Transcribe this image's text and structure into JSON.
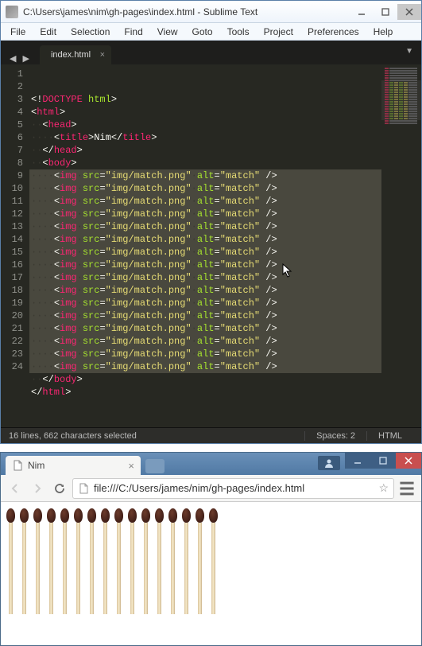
{
  "sublime": {
    "title": "C:\\Users\\james\\nim\\gh-pages\\index.html - Sublime Text",
    "menus": [
      "File",
      "Edit",
      "Selection",
      "Find",
      "View",
      "Goto",
      "Tools",
      "Project",
      "Preferences",
      "Help"
    ],
    "tab": "index.html",
    "lines": [
      {
        "num": 1,
        "sel": false,
        "indent": 0,
        "segments": [
          {
            "t": "<!",
            "c": "punct"
          },
          {
            "t": "DOCTYPE",
            "c": "tag"
          },
          {
            "t": " ",
            "c": "punct"
          },
          {
            "t": "html",
            "c": "attr"
          },
          {
            "t": ">",
            "c": "punct"
          }
        ]
      },
      {
        "num": 2,
        "sel": false,
        "indent": 0,
        "segments": [
          {
            "t": "<",
            "c": "punct"
          },
          {
            "t": "html",
            "c": "tag"
          },
          {
            "t": ">",
            "c": "punct"
          }
        ]
      },
      {
        "num": 3,
        "sel": false,
        "indent": 1,
        "segments": [
          {
            "t": "<",
            "c": "punct"
          },
          {
            "t": "head",
            "c": "tag"
          },
          {
            "t": ">",
            "c": "punct"
          }
        ]
      },
      {
        "num": 4,
        "sel": false,
        "indent": 2,
        "segments": [
          {
            "t": "<",
            "c": "punct"
          },
          {
            "t": "title",
            "c": "tag"
          },
          {
            "t": ">",
            "c": "punct"
          },
          {
            "t": "Nim",
            "c": "punct"
          },
          {
            "t": "</",
            "c": "punct"
          },
          {
            "t": "title",
            "c": "tag"
          },
          {
            "t": ">",
            "c": "punct"
          }
        ]
      },
      {
        "num": 5,
        "sel": false,
        "indent": 1,
        "segments": [
          {
            "t": "</",
            "c": "punct"
          },
          {
            "t": "head",
            "c": "tag"
          },
          {
            "t": ">",
            "c": "punct"
          }
        ]
      },
      {
        "num": 6,
        "sel": false,
        "indent": 1,
        "segments": [
          {
            "t": "<",
            "c": "punct"
          },
          {
            "t": "body",
            "c": "tag"
          },
          {
            "t": ">",
            "c": "punct"
          }
        ]
      },
      {
        "num": 7,
        "sel": true,
        "indent": 2,
        "segments": [
          {
            "t": "<",
            "c": "punct"
          },
          {
            "t": "img",
            "c": "tag"
          },
          {
            "t": " ",
            "c": "ws"
          },
          {
            "t": "src",
            "c": "attr"
          },
          {
            "t": "=",
            "c": "punct"
          },
          {
            "t": "\"img/match.png\"",
            "c": "str"
          },
          {
            "t": " ",
            "c": "ws"
          },
          {
            "t": "alt",
            "c": "attr"
          },
          {
            "t": "=",
            "c": "punct"
          },
          {
            "t": "\"match\"",
            "c": "str"
          },
          {
            "t": " />",
            "c": "punct"
          }
        ]
      },
      {
        "num": 8,
        "sel": true,
        "indent": 2,
        "segments": [
          {
            "t": "<",
            "c": "punct"
          },
          {
            "t": "img",
            "c": "tag"
          },
          {
            "t": " ",
            "c": "ws"
          },
          {
            "t": "src",
            "c": "attr"
          },
          {
            "t": "=",
            "c": "punct"
          },
          {
            "t": "\"img/match.png\"",
            "c": "str"
          },
          {
            "t": " ",
            "c": "ws"
          },
          {
            "t": "alt",
            "c": "attr"
          },
          {
            "t": "=",
            "c": "punct"
          },
          {
            "t": "\"match\"",
            "c": "str"
          },
          {
            "t": " />",
            "c": "punct"
          }
        ]
      },
      {
        "num": 9,
        "sel": true,
        "indent": 2,
        "segments": [
          {
            "t": "<",
            "c": "punct"
          },
          {
            "t": "img",
            "c": "tag"
          },
          {
            "t": " ",
            "c": "ws"
          },
          {
            "t": "src",
            "c": "attr"
          },
          {
            "t": "=",
            "c": "punct"
          },
          {
            "t": "\"img/match.png\"",
            "c": "str"
          },
          {
            "t": " ",
            "c": "ws"
          },
          {
            "t": "alt",
            "c": "attr"
          },
          {
            "t": "=",
            "c": "punct"
          },
          {
            "t": "\"match\"",
            "c": "str"
          },
          {
            "t": " />",
            "c": "punct"
          }
        ]
      },
      {
        "num": 10,
        "sel": true,
        "indent": 2,
        "segments": [
          {
            "t": "<",
            "c": "punct"
          },
          {
            "t": "img",
            "c": "tag"
          },
          {
            "t": " ",
            "c": "ws"
          },
          {
            "t": "src",
            "c": "attr"
          },
          {
            "t": "=",
            "c": "punct"
          },
          {
            "t": "\"img/match.png\"",
            "c": "str"
          },
          {
            "t": " ",
            "c": "ws"
          },
          {
            "t": "alt",
            "c": "attr"
          },
          {
            "t": "=",
            "c": "punct"
          },
          {
            "t": "\"match\"",
            "c": "str"
          },
          {
            "t": " />",
            "c": "punct"
          }
        ]
      },
      {
        "num": 11,
        "sel": true,
        "indent": 2,
        "segments": [
          {
            "t": "<",
            "c": "punct"
          },
          {
            "t": "img",
            "c": "tag"
          },
          {
            "t": " ",
            "c": "ws"
          },
          {
            "t": "src",
            "c": "attr"
          },
          {
            "t": "=",
            "c": "punct"
          },
          {
            "t": "\"img/match.png\"",
            "c": "str"
          },
          {
            "t": " ",
            "c": "ws"
          },
          {
            "t": "alt",
            "c": "attr"
          },
          {
            "t": "=",
            "c": "punct"
          },
          {
            "t": "\"match\"",
            "c": "str"
          },
          {
            "t": " />",
            "c": "punct"
          }
        ]
      },
      {
        "num": 12,
        "sel": true,
        "indent": 2,
        "segments": [
          {
            "t": "<",
            "c": "punct"
          },
          {
            "t": "img",
            "c": "tag"
          },
          {
            "t": " ",
            "c": "ws"
          },
          {
            "t": "src",
            "c": "attr"
          },
          {
            "t": "=",
            "c": "punct"
          },
          {
            "t": "\"img/match.png\"",
            "c": "str"
          },
          {
            "t": " ",
            "c": "ws"
          },
          {
            "t": "alt",
            "c": "attr"
          },
          {
            "t": "=",
            "c": "punct"
          },
          {
            "t": "\"match\"",
            "c": "str"
          },
          {
            "t": " />",
            "c": "punct"
          }
        ]
      },
      {
        "num": 13,
        "sel": true,
        "indent": 2,
        "segments": [
          {
            "t": "<",
            "c": "punct"
          },
          {
            "t": "img",
            "c": "tag"
          },
          {
            "t": " ",
            "c": "ws"
          },
          {
            "t": "src",
            "c": "attr"
          },
          {
            "t": "=",
            "c": "punct"
          },
          {
            "t": "\"img/match.png\"",
            "c": "str"
          },
          {
            "t": " ",
            "c": "ws"
          },
          {
            "t": "alt",
            "c": "attr"
          },
          {
            "t": "=",
            "c": "punct"
          },
          {
            "t": "\"match\"",
            "c": "str"
          },
          {
            "t": " />",
            "c": "punct"
          }
        ]
      },
      {
        "num": 14,
        "sel": true,
        "indent": 2,
        "segments": [
          {
            "t": "<",
            "c": "punct"
          },
          {
            "t": "img",
            "c": "tag"
          },
          {
            "t": " ",
            "c": "ws"
          },
          {
            "t": "src",
            "c": "attr"
          },
          {
            "t": "=",
            "c": "punct"
          },
          {
            "t": "\"img/match.png\"",
            "c": "str"
          },
          {
            "t": " ",
            "c": "ws"
          },
          {
            "t": "alt",
            "c": "attr"
          },
          {
            "t": "=",
            "c": "punct"
          },
          {
            "t": "\"match\"",
            "c": "str"
          },
          {
            "t": " />",
            "c": "punct"
          }
        ]
      },
      {
        "num": 15,
        "sel": true,
        "indent": 2,
        "segments": [
          {
            "t": "<",
            "c": "punct"
          },
          {
            "t": "img",
            "c": "tag"
          },
          {
            "t": " ",
            "c": "ws"
          },
          {
            "t": "src",
            "c": "attr"
          },
          {
            "t": "=",
            "c": "punct"
          },
          {
            "t": "\"img/match.png\"",
            "c": "str"
          },
          {
            "t": " ",
            "c": "ws"
          },
          {
            "t": "alt",
            "c": "attr"
          },
          {
            "t": "=",
            "c": "punct"
          },
          {
            "t": "\"match\"",
            "c": "str"
          },
          {
            "t": " />",
            "c": "punct"
          }
        ]
      },
      {
        "num": 16,
        "sel": true,
        "indent": 2,
        "segments": [
          {
            "t": "<",
            "c": "punct"
          },
          {
            "t": "img",
            "c": "tag"
          },
          {
            "t": " ",
            "c": "ws"
          },
          {
            "t": "src",
            "c": "attr"
          },
          {
            "t": "=",
            "c": "punct"
          },
          {
            "t": "\"img/match.png\"",
            "c": "str"
          },
          {
            "t": " ",
            "c": "ws"
          },
          {
            "t": "alt",
            "c": "attr"
          },
          {
            "t": "=",
            "c": "punct"
          },
          {
            "t": "\"match\"",
            "c": "str"
          },
          {
            "t": " />",
            "c": "punct"
          }
        ]
      },
      {
        "num": 17,
        "sel": true,
        "indent": 2,
        "segments": [
          {
            "t": "<",
            "c": "punct"
          },
          {
            "t": "img",
            "c": "tag"
          },
          {
            "t": " ",
            "c": "ws"
          },
          {
            "t": "src",
            "c": "attr"
          },
          {
            "t": "=",
            "c": "punct"
          },
          {
            "t": "\"img/match.png\"",
            "c": "str"
          },
          {
            "t": " ",
            "c": "ws"
          },
          {
            "t": "alt",
            "c": "attr"
          },
          {
            "t": "=",
            "c": "punct"
          },
          {
            "t": "\"match\"",
            "c": "str"
          },
          {
            "t": " />",
            "c": "punct"
          }
        ]
      },
      {
        "num": 18,
        "sel": true,
        "indent": 2,
        "segments": [
          {
            "t": "<",
            "c": "punct"
          },
          {
            "t": "img",
            "c": "tag"
          },
          {
            "t": " ",
            "c": "ws"
          },
          {
            "t": "src",
            "c": "attr"
          },
          {
            "t": "=",
            "c": "punct"
          },
          {
            "t": "\"img/match.png\"",
            "c": "str"
          },
          {
            "t": " ",
            "c": "ws"
          },
          {
            "t": "alt",
            "c": "attr"
          },
          {
            "t": "=",
            "c": "punct"
          },
          {
            "t": "\"match\"",
            "c": "str"
          },
          {
            "t": " />",
            "c": "punct"
          }
        ]
      },
      {
        "num": 19,
        "sel": true,
        "indent": 2,
        "segments": [
          {
            "t": "<",
            "c": "punct"
          },
          {
            "t": "img",
            "c": "tag"
          },
          {
            "t": " ",
            "c": "ws"
          },
          {
            "t": "src",
            "c": "attr"
          },
          {
            "t": "=",
            "c": "punct"
          },
          {
            "t": "\"img/match.png\"",
            "c": "str"
          },
          {
            "t": " ",
            "c": "ws"
          },
          {
            "t": "alt",
            "c": "attr"
          },
          {
            "t": "=",
            "c": "punct"
          },
          {
            "t": "\"match\"",
            "c": "str"
          },
          {
            "t": " />",
            "c": "punct"
          }
        ]
      },
      {
        "num": 20,
        "sel": true,
        "indent": 2,
        "segments": [
          {
            "t": "<",
            "c": "punct"
          },
          {
            "t": "img",
            "c": "tag"
          },
          {
            "t": " ",
            "c": "ws"
          },
          {
            "t": "src",
            "c": "attr"
          },
          {
            "t": "=",
            "c": "punct"
          },
          {
            "t": "\"img/match.png\"",
            "c": "str"
          },
          {
            "t": " ",
            "c": "ws"
          },
          {
            "t": "alt",
            "c": "attr"
          },
          {
            "t": "=",
            "c": "punct"
          },
          {
            "t": "\"match\"",
            "c": "str"
          },
          {
            "t": " />",
            "c": "punct"
          }
        ]
      },
      {
        "num": 21,
        "sel": true,
        "indent": 2,
        "segments": [
          {
            "t": "<",
            "c": "punct"
          },
          {
            "t": "img",
            "c": "tag"
          },
          {
            "t": " ",
            "c": "ws"
          },
          {
            "t": "src",
            "c": "attr"
          },
          {
            "t": "=",
            "c": "punct"
          },
          {
            "t": "\"img/match.png\"",
            "c": "str"
          },
          {
            "t": " ",
            "c": "ws"
          },
          {
            "t": "alt",
            "c": "attr"
          },
          {
            "t": "=",
            "c": "punct"
          },
          {
            "t": "\"match\"",
            "c": "str"
          },
          {
            "t": " />",
            "c": "punct"
          }
        ]
      },
      {
        "num": 22,
        "sel": true,
        "indent": 2,
        "segments": [
          {
            "t": "<",
            "c": "punct"
          },
          {
            "t": "img",
            "c": "tag"
          },
          {
            "t": " ",
            "c": "punct"
          },
          {
            "t": "src",
            "c": "attr"
          },
          {
            "t": "=",
            "c": "punct"
          },
          {
            "t": "\"img/match.png\"",
            "c": "str"
          },
          {
            "t": " ",
            "c": "punct"
          },
          {
            "t": "alt",
            "c": "attr"
          },
          {
            "t": "=",
            "c": "punct"
          },
          {
            "t": "\"match\"",
            "c": "str"
          },
          {
            "t": " />",
            "c": "punct"
          }
        ]
      },
      {
        "num": 23,
        "sel": false,
        "indent": 1,
        "segments": [
          {
            "t": "</",
            "c": "punct"
          },
          {
            "t": "body",
            "c": "tag"
          },
          {
            "t": ">",
            "c": "punct"
          }
        ]
      },
      {
        "num": 24,
        "sel": false,
        "indent": 0,
        "segments": [
          {
            "t": "</",
            "c": "punct"
          },
          {
            "t": "html",
            "c": "tag"
          },
          {
            "t": ">",
            "c": "punct"
          }
        ]
      }
    ],
    "status": {
      "left": "16 lines, 662 characters selected",
      "spaces": "Spaces: 2",
      "syntax": "HTML"
    }
  },
  "chrome": {
    "tab_title": "Nim",
    "url": "file:///C:/Users/james/nim/gh-pages/index.html",
    "match_count": 16
  }
}
